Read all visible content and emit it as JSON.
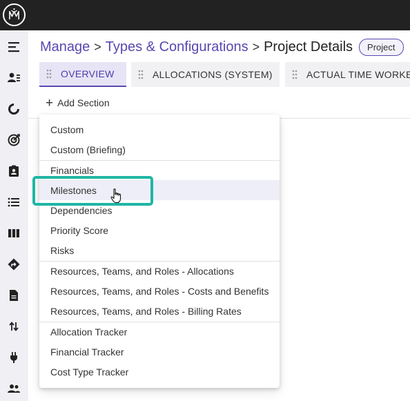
{
  "app": {
    "logo": "mm-logo-icon",
    "colors": {
      "accent": "#5848b0",
      "highlight": "#1fb6a4",
      "topbar": "#222222",
      "sidebar": "#f0f0f4"
    }
  },
  "sidebar": {
    "items": [
      {
        "icon": "menu-collapse-icon"
      },
      {
        "icon": "user-list-icon"
      },
      {
        "icon": "progress-icon"
      },
      {
        "icon": "target-icon"
      },
      {
        "icon": "contact-clipboard-icon"
      },
      {
        "icon": "list-icon"
      },
      {
        "icon": "board-columns-icon"
      },
      {
        "icon": "directions-icon"
      },
      {
        "icon": "document-icon"
      },
      {
        "icon": "swap-vertical-icon"
      },
      {
        "icon": "plug-icon"
      },
      {
        "icon": "people-icon"
      }
    ]
  },
  "breadcrumb": {
    "items": [
      "Manage",
      "Types & Configurations",
      "Project Details"
    ],
    "separator": ">",
    "badge": "Project"
  },
  "tabs": [
    {
      "label": "OVERVIEW",
      "active": true
    },
    {
      "label": "ALLOCATIONS (SYSTEM)",
      "active": false
    },
    {
      "label": "ACTUAL TIME WORKED",
      "active": false
    }
  ],
  "add_section": {
    "label": "Add Section"
  },
  "menu": {
    "groups": [
      [
        "Custom",
        "Custom (Briefing)"
      ],
      [
        "Financials",
        "Milestones",
        "Dependencies",
        "Priority Score",
        "Risks"
      ],
      [
        "Resources, Teams, and Roles - Allocations",
        "Resources, Teams, and Roles - Costs and Benefits",
        "Resources, Teams, and Roles - Billing Rates"
      ],
      [
        "Allocation Tracker",
        "Financial Tracker",
        "Cost Type Tracker"
      ]
    ],
    "hovered": "Milestones"
  }
}
